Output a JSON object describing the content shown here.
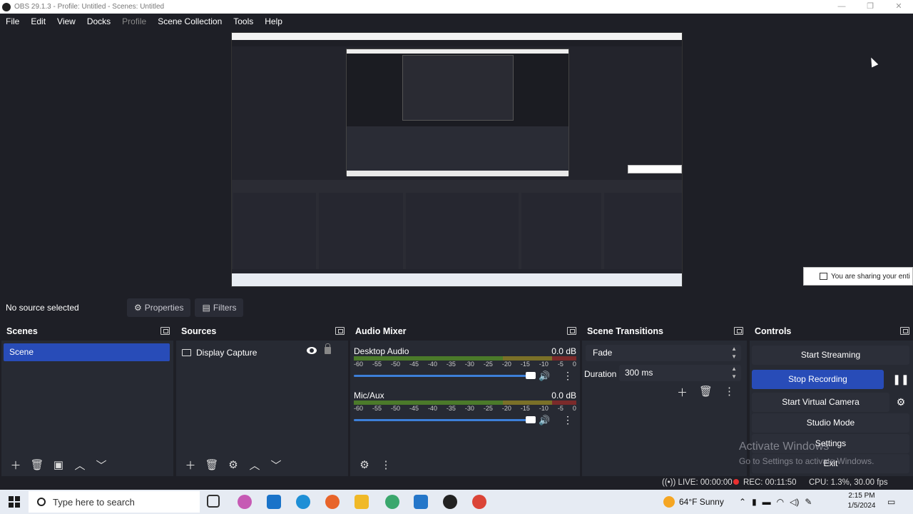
{
  "window": {
    "title": "OBS 29.1.3 - Profile: Untitled - Scenes: Untitled",
    "controls": [
      "—",
      "❐",
      "✕"
    ]
  },
  "menu": {
    "items": [
      "File",
      "Edit",
      "View",
      "Docks",
      "Profile",
      "Scene Collection",
      "Tools",
      "Help"
    ]
  },
  "share_popup": {
    "text": "You are sharing your enti"
  },
  "context": {
    "no_source": "No source selected",
    "properties_label": "Properties",
    "filters_label": "Filters"
  },
  "scenes": {
    "title": "Scenes",
    "items": [
      "Scene"
    ]
  },
  "sources": {
    "title": "Sources",
    "items": [
      "Display Capture"
    ]
  },
  "mixer": {
    "title": "Audio Mixer",
    "ticks": [
      "-60",
      "-55",
      "-50",
      "-45",
      "-40",
      "-35",
      "-30",
      "-25",
      "-20",
      "-15",
      "-10",
      "-5",
      "0"
    ],
    "channels": [
      {
        "name": "Desktop Audio",
        "db": "0.0 dB",
        "volume": 1.0
      },
      {
        "name": "Mic/Aux",
        "db": "0.0 dB",
        "volume": 1.0
      }
    ]
  },
  "transitions": {
    "title": "Scene Transitions",
    "selected": "Fade",
    "duration_label": "Duration",
    "duration_value": "300 ms"
  },
  "controls": {
    "title": "Controls",
    "start_streaming": "Start Streaming",
    "stop_recording": "Stop Recording",
    "start_virtual_camera": "Start Virtual Camera",
    "studio_mode": "Studio Mode",
    "settings": "Settings",
    "exit": "Exit"
  },
  "watermark": {
    "line1": "Activate Windows",
    "line2": "Go to Settings to activate Windows."
  },
  "status": {
    "live": "LIVE: 00:00:00",
    "rec": "REC: 00:11:50",
    "cpu": "CPU: 1.3%, 30.00 fps"
  },
  "taskbar": {
    "search_placeholder": "Type here to search",
    "weather": "64°F  Sunny",
    "time": "2:15 PM",
    "date": "1/5/2024"
  },
  "colors": {
    "accent": "#284cb8",
    "background": "#1e1f26",
    "panel": "#272a33"
  }
}
